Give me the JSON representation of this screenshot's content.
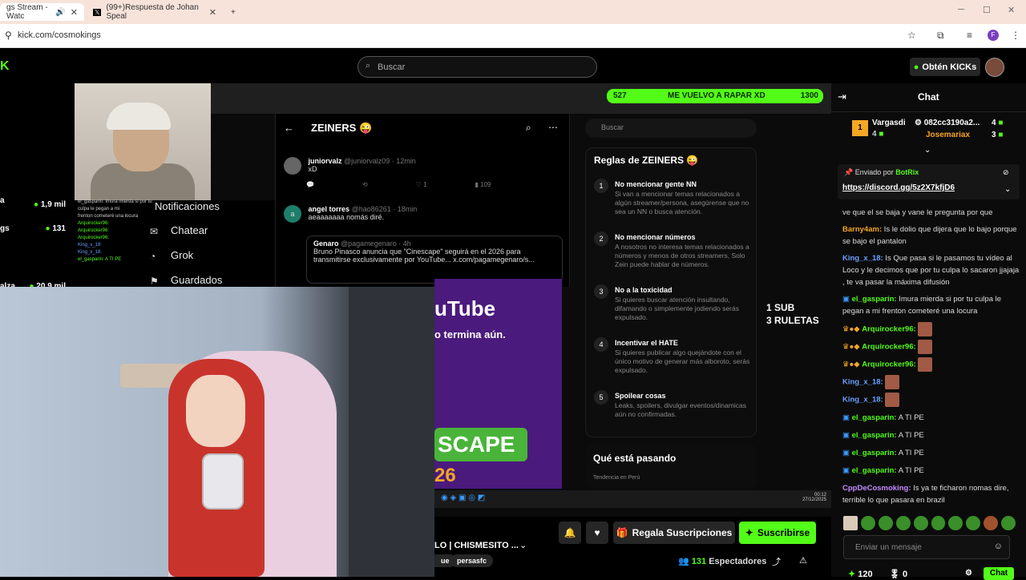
{
  "browser": {
    "tabs": [
      {
        "label": "gs Stream - Watc"
      },
      {
        "label": "(99+)Respuesta de Johan Speal"
      }
    ],
    "new_tab": "+",
    "url": "kick.com/cosmokings"
  },
  "header": {
    "search_placeholder": "Buscar",
    "kicks_label": "Obtén KICKs"
  },
  "sidebar": {
    "items": [
      {
        "name": "",
        "value": "1,9 mil"
      },
      {
        "name": "a",
        "value": ""
      },
      {
        "name": "gs",
        "value": "131"
      },
      {
        "name": "alza",
        "value": "20,9 mil"
      }
    ]
  },
  "stream": {
    "x_nav": [
      "Notificaciones",
      "Chatear",
      "Grok",
      "Guardados"
    ],
    "mini_chat": [
      "el_gasparin: Imura mierda si por tu culpa le pegan a mi",
      "frenton cometeré una locura",
      "Arquirocker96:",
      "Arquirocker96:",
      "Arquirocker96:",
      "King_x_18:",
      "King_x_18:",
      "el_gasparin: A TI PE"
    ],
    "goal": {
      "count_left": "527",
      "label": "ME VUELVO A RAPAR XD",
      "count_right": "1300"
    },
    "x_title": "ZEINERS 😜",
    "posts": [
      {
        "name": "juniorvalz",
        "handle": "@juniorvalz09 · 12min",
        "text": "xD",
        "likes": "1",
        "views": "109"
      },
      {
        "name": "angel torres",
        "handle": "@hao86261 · 18min",
        "text": "aeaaaaaaa nomás diré."
      }
    ],
    "quote": {
      "name": "Genaro",
      "handle": "@pagamegenaro · 4h",
      "text": "Bruno Pinasco anuncia que \"Cinescape\" seguirá en el 2026 para transmitirse exclusivamente por YouTube... x.com/pagamegenaro/s..."
    },
    "promo": {
      "t1": "uTube",
      "t2": "o termina aún.",
      "t3": "SCAPE",
      "t4": "26"
    },
    "x_search": "Buscar",
    "rules_title": "Reglas de ZEINERS 😜",
    "rules": [
      {
        "n": "1",
        "title": "No mencionar gente NN",
        "desc": "Si van a mencionar temas relacionados a algún streamer/persona, asegúrense que no sea un NN o busca atención."
      },
      {
        "n": "2",
        "title": "No mencionar números",
        "desc": "A nosotros no interesa temas relacionados a números y menos de otros streamers, Solo Zein puede hablar de números."
      },
      {
        "n": "3",
        "title": "No a la toxicidad",
        "desc": "Si quieres buscar atención insultando, difamando o simplemente jodiendo serás expulsado."
      },
      {
        "n": "4",
        "title": "Incentivar el HATE",
        "desc": "Si quieres publicar algo quejándote con el único motivo de generar más alboroto, serás expulsado."
      },
      {
        "n": "5",
        "title": "Spoilear cosas",
        "desc": "Leaks, spoilers, divulgar eventos/dinamicas aún no confirmadas."
      }
    ],
    "happening": {
      "title": "Qué está pasando",
      "sub": "Tendencia en Perú"
    },
    "overlay": {
      "line1": "1 SUB",
      "line2": "3 RULETAS"
    },
    "clock": {
      "time": "00:12",
      "date": "27/12/2025"
    }
  },
  "under_stream": {
    "gift_label": "Regala Suscripciones",
    "subscribe_label": "Suscribirse",
    "title": "LO | CHISMESITO ...",
    "tags": [
      "ue",
      "persasfc"
    ],
    "viewers_count": "131",
    "viewers_label": "Espectadores"
  },
  "chat": {
    "title": "Chat",
    "top": [
      {
        "rank": "1",
        "name": "Vargasdi",
        "value": "4"
      },
      {
        "name": "082cc3190a2...",
        "value": "4"
      },
      {
        "name": "Josemariax",
        "value": "3"
      }
    ],
    "pinned": {
      "by_label": "Enviado por",
      "by_user": "BotRix",
      "link": "https://discord.gg/5z2X7kfjD6"
    },
    "messages": [
      {
        "user": "",
        "text": "ve que el se baja y vane le pregunta por que",
        "color": "#dddddd"
      },
      {
        "user": "Barny4am:",
        "text": " Is le dolio que dijera que lo bajo porque se bajo el pantalon",
        "color": "#f5a623"
      },
      {
        "user": "King_x_18:",
        "text": " Is Que pasa si le pasamos tu vídeo al Loco y le decimos que por tu culpa lo sacaron jjajaja , te va pasar la máxima difusión",
        "color": "#6aa0ff"
      },
      {
        "user": "el_gasparin:",
        "text": " Imura mierda si por tu culpa le pegan a mi frenton cometeré una locura",
        "color": "#53fc18"
      },
      {
        "user": "Arquirocker96:",
        "text": "",
        "color": "#53fc18"
      },
      {
        "user": "Arquirocker96:",
        "text": "",
        "color": "#53fc18"
      },
      {
        "user": "Arquirocker96:",
        "text": "",
        "color": "#53fc18"
      },
      {
        "user": "King_x_18:",
        "text": "",
        "color": "#6aa0ff"
      },
      {
        "user": "King_x_18:",
        "text": "",
        "color": "#6aa0ff"
      },
      {
        "user": "el_gasparin:",
        "text": " A TI PE",
        "color": "#53fc18"
      },
      {
        "user": "el_gasparin:",
        "text": " A TI PE",
        "color": "#53fc18"
      },
      {
        "user": "el_gasparin:",
        "text": " A TI PE",
        "color": "#53fc18"
      },
      {
        "user": "el_gasparin:",
        "text": " A TI PE",
        "color": "#53fc18"
      },
      {
        "user": "CppDeCosmoking:",
        "text": " Is ya te ficharon nomas dire, terrible lo que pasara en brazil",
        "color": "#c58cff"
      }
    ],
    "input_placeholder": "Enviar un mensaje",
    "kicks_count": "120",
    "points_count": "0",
    "send_label": "Chat"
  },
  "colors": {
    "accent": "#53fc18",
    "background": "#0b0b0b"
  }
}
